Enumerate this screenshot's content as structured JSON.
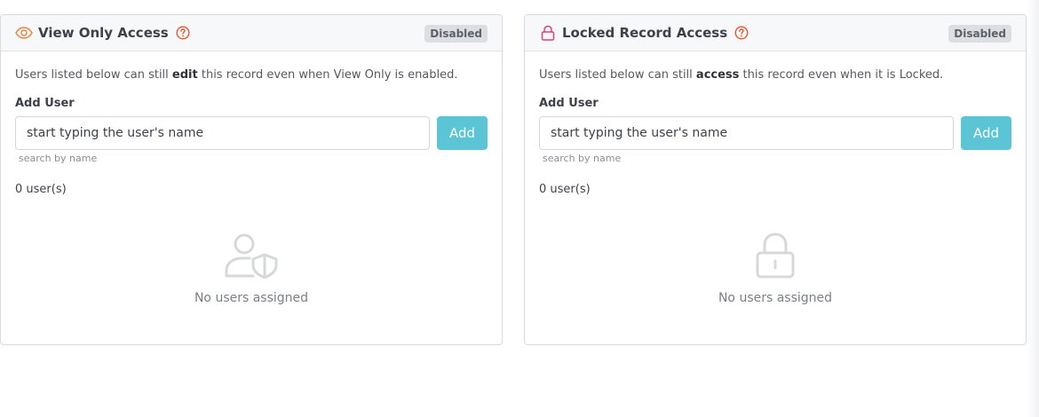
{
  "panels": [
    {
      "title": "View Only Access",
      "header_icon": "eye-icon",
      "help_icon": "question-circle-icon",
      "badge": "Disabled",
      "description_before": "Users listed below can still ",
      "description_bold": "edit",
      "description_after": " this record even when View Only is enabled.",
      "add_label": "Add User",
      "input_placeholder": "start typing the user's name",
      "add_button": "Add",
      "hint": "search by name",
      "count": "0 user(s)",
      "empty_icon": "user-shield-icon",
      "empty_text": "No users assigned"
    },
    {
      "title": "Locked Record Access",
      "header_icon": "lock-icon",
      "help_icon": "question-circle-icon",
      "badge": "Disabled",
      "description_before": "Users listed below can still ",
      "description_bold": "access",
      "description_after": " this record even when it is Locked.",
      "add_label": "Add User",
      "input_placeholder": "start typing the user's name",
      "add_button": "Add",
      "hint": "search by name",
      "count": "0 user(s)",
      "empty_icon": "lock-icon",
      "empty_text": "No users assigned"
    }
  ],
  "colors": {
    "eye_icon": "#e8823a",
    "lock_icon": "#d8436e",
    "help_icon": "#e6572e",
    "add_button": "#5bc4d5",
    "badge_bg": "#dcdee2"
  }
}
